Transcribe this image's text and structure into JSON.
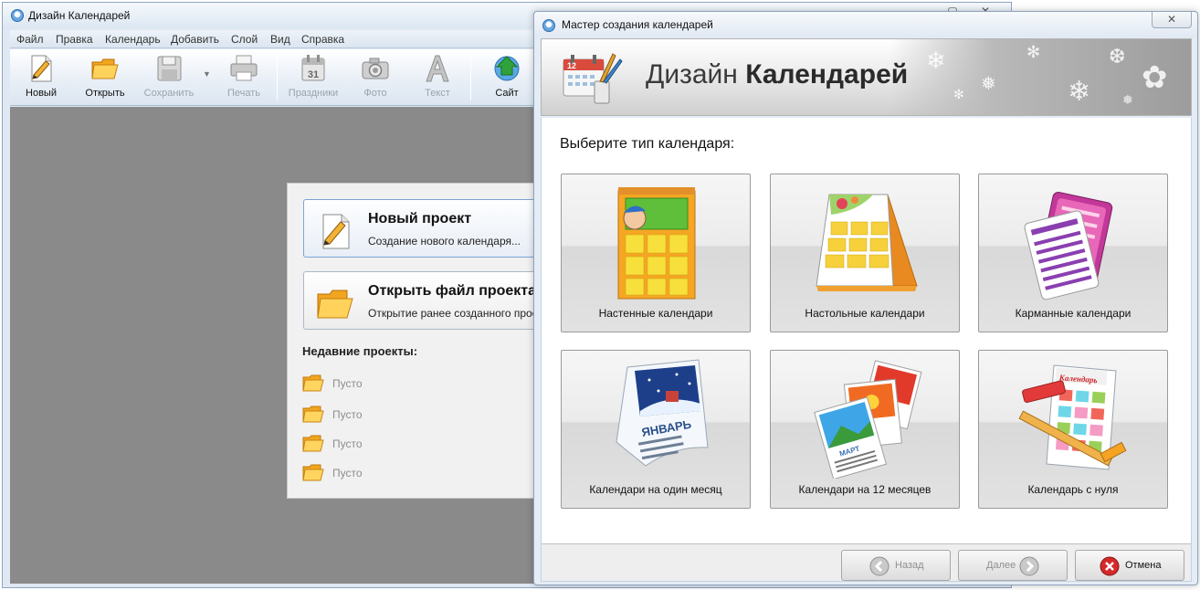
{
  "main_window": {
    "title": "Дизайн Календарей",
    "menu": [
      "Файл",
      "Правка",
      "Календарь",
      "Добавить",
      "Слой",
      "Вид",
      "Справка"
    ],
    "toolbar": {
      "new": "Новый",
      "open": "Открыть",
      "save": "Сохранить",
      "print": "Печать",
      "holidays": "Праздники",
      "photo": "Фото",
      "text": "Текст",
      "site": "Сайт",
      "holidays_icon_number": "31"
    }
  },
  "start_panel": {
    "new_project": {
      "title": "Новый проект",
      "subtitle": "Создание нового календаря..."
    },
    "open_project": {
      "title": "Открыть файл проекта",
      "subtitle": "Открытие ранее созданного проекта"
    },
    "recent_title": "Недавние проекты:",
    "recent": [
      "Пусто",
      "Пусто",
      "Пусто",
      "Пусто"
    ]
  },
  "wizard": {
    "title": "Мастер создания календарей",
    "close_symbol": "✕",
    "banner": {
      "title_light": "Дизайн",
      "title_bold": "Календарей",
      "icon_number": "12"
    },
    "prompt": "Выберите тип календаря:",
    "types": [
      {
        "label": "Настенные календари",
        "icon": "wall-calendar-icon"
      },
      {
        "label": "Настольные календари",
        "icon": "desk-calendar-icon"
      },
      {
        "label": "Карманные календари",
        "icon": "pocket-calendar-icon"
      },
      {
        "label": "Календари на один месяц",
        "icon": "one-month-calendar-icon",
        "art_text": "ЯНВАРЬ"
      },
      {
        "label": "Календари на 12 месяцев",
        "icon": "twelve-month-calendar-icon",
        "art_text": "МАРТ"
      },
      {
        "label": "Календарь с нуля",
        "icon": "from-scratch-calendar-icon",
        "art_text": "Календарь"
      }
    ],
    "buttons": {
      "back": "Назад",
      "next": "Далее",
      "cancel": "Отмена"
    }
  },
  "colors": {
    "workspace_bg": "#8a8a8a",
    "cancel_red": "#d42a2a",
    "folder_orange": "#f2a51f",
    "site_green": "#2fa23c"
  }
}
